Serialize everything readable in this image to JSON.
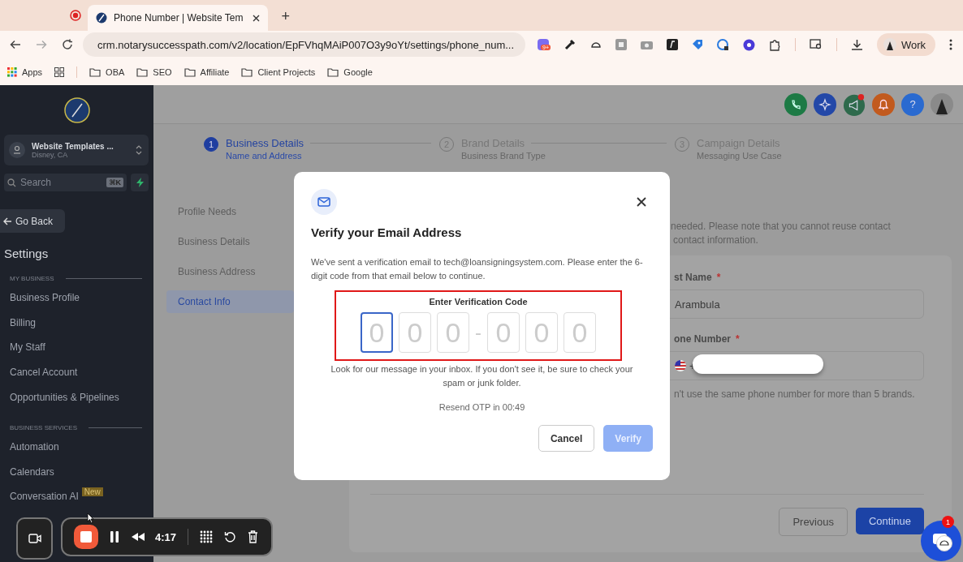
{
  "browser": {
    "tab": {
      "title": "Phone Number | Website Tem",
      "selected": true
    },
    "new_tab": "+",
    "url": "crm.notarysuccesspath.com/v2/location/EpFVhqMAiP007O3y9oYt/settings/phone_num...",
    "extension_badge": "9+",
    "profile": "Work",
    "bookmarks": [
      {
        "label": "Apps",
        "kind": "apps"
      },
      {
        "label": "OBA",
        "kind": "folder"
      },
      {
        "label": "SEO",
        "kind": "folder"
      },
      {
        "label": "Affiliate",
        "kind": "folder"
      },
      {
        "label": "Client Projects",
        "kind": "folder"
      },
      {
        "label": "Google",
        "kind": "folder"
      }
    ]
  },
  "sidebar": {
    "account": {
      "name": "Website Templates ...",
      "location": "Disney, CA"
    },
    "search": {
      "placeholder": "Search",
      "shortcut": "⌘K"
    },
    "back": "Go Back",
    "heading": "Settings",
    "sections": [
      {
        "title": "MY BUSINESS",
        "items": [
          {
            "label": "Business Profile"
          },
          {
            "label": "Billing"
          },
          {
            "label": "My Staff"
          },
          {
            "label": "Cancel Account"
          },
          {
            "label": "Opportunities & Pipelines"
          }
        ]
      },
      {
        "title": "BUSINESS SERVICES",
        "items": [
          {
            "label": "Automation"
          },
          {
            "label": "Calendars"
          },
          {
            "label": "Conversation AI",
            "badge": "New"
          }
        ]
      }
    ]
  },
  "header": {
    "help": "?",
    "notification_dot": true
  },
  "steps": [
    {
      "number": "1",
      "title": "Business Details",
      "subtitle": "Name and Address",
      "selected": true
    },
    {
      "number": "2",
      "title": "Brand Details",
      "subtitle": "Business Brand Type",
      "selected": false
    },
    {
      "number": "3",
      "title": "Campaign Details",
      "subtitle": "Messaging Use Case",
      "selected": false
    }
  ],
  "form_nav": [
    {
      "label": "Profile Needs",
      "selected": false
    },
    {
      "label": "Business Details",
      "selected": false
    },
    {
      "label": "Business Address",
      "selected": false
    },
    {
      "label": "Contact Info",
      "selected": true
    }
  ],
  "form": {
    "note_lines": [
      "needed. Please note that you cannot reuse contact",
      "contact information."
    ],
    "fields": [
      {
        "label": "st Name",
        "required_mark": "*",
        "kind": "text",
        "value": "Arambula"
      },
      {
        "label": "one Number",
        "required_mark": "*",
        "kind": "phone",
        "value": "+"
      }
    ],
    "hint": "n't use the same phone number for more than 5 brands.",
    "buttons": [
      {
        "label": "Previous",
        "kind": "secondary"
      },
      {
        "label": "Continue",
        "kind": "primary"
      }
    ]
  },
  "modal": {
    "title": "Verify your Email Address",
    "message": "We've sent a verification email to tech@loansigningsystem.com. Please enter the 6-digit code from that email below to continue.",
    "code_label": "Enter Verification Code",
    "highlighted": true,
    "digits": [
      {
        "placeholder": "0",
        "focused": true
      },
      {
        "placeholder": "0",
        "focused": false
      },
      {
        "placeholder": "0",
        "focused": false
      },
      {
        "placeholder": "0",
        "focused": false
      },
      {
        "placeholder": "0",
        "focused": false
      },
      {
        "placeholder": "0",
        "focused": false
      }
    ],
    "separator": "-",
    "help": "Look for our message in your inbox. If you don't see it, be sure to check your spam or junk folder.",
    "resend": "Resend OTP in 00:49",
    "buttons": [
      {
        "label": "Cancel",
        "kind": "secondary",
        "disabled": false
      },
      {
        "label": "Verify",
        "kind": "primary",
        "disabled": true
      }
    ]
  },
  "recorder": {
    "time": "4:17"
  },
  "chat": {
    "badge": "1"
  }
}
